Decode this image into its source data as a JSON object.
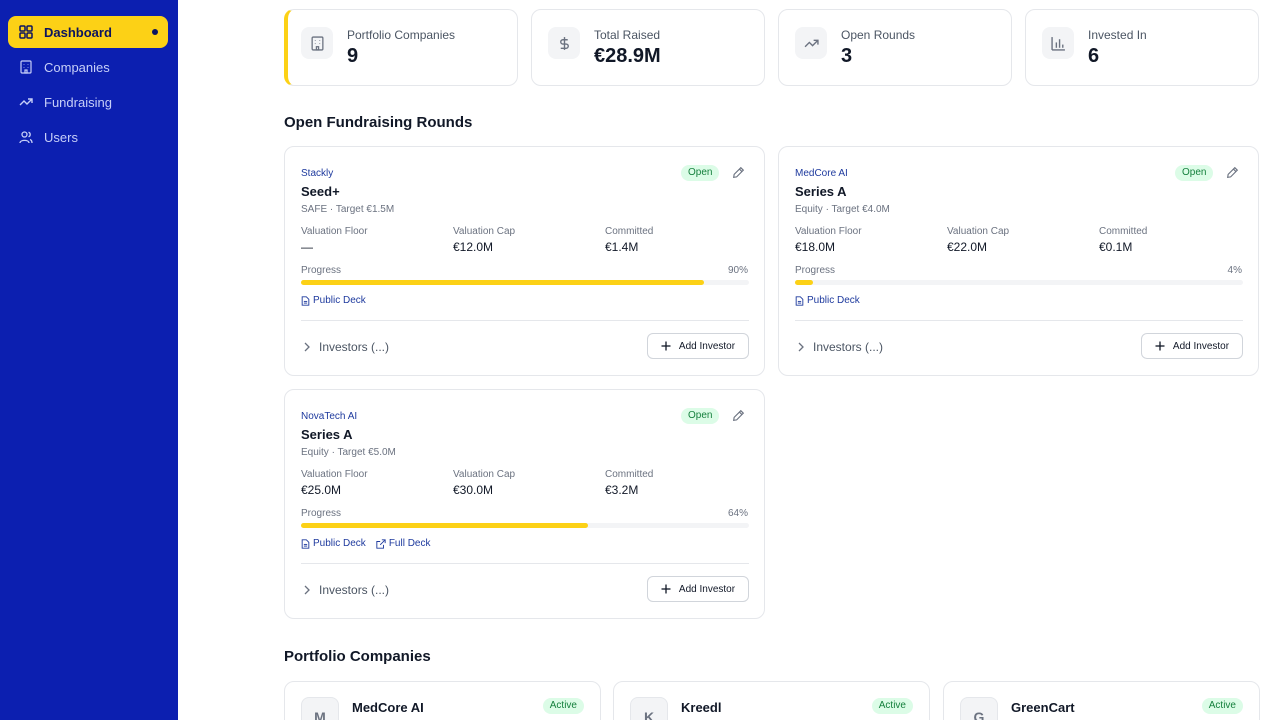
{
  "sidebar": {
    "items": [
      {
        "label": "Dashboard",
        "icon": "dashboard-icon",
        "active": true
      },
      {
        "label": "Companies",
        "icon": "building-icon"
      },
      {
        "label": "Fundraising",
        "icon": "trending-up-icon"
      },
      {
        "label": "Users",
        "icon": "users-icon"
      }
    ]
  },
  "stats": [
    {
      "label": "Portfolio Companies",
      "value": "9",
      "icon": "building-icon"
    },
    {
      "label": "Total Raised",
      "value": "€28.9M",
      "icon": "dollar-icon"
    },
    {
      "label": "Open Rounds",
      "value": "3",
      "icon": "trending-up-icon"
    },
    {
      "label": "Invested In",
      "value": "6",
      "icon": "bar-chart-icon"
    }
  ],
  "rounds_section": {
    "title": "Open Fundraising Rounds"
  },
  "rounds": [
    {
      "company": "Stackly",
      "name": "Seed+",
      "type": "SAFE · Target €1.5M",
      "status": "Open",
      "floor_label": "Valuation Floor",
      "floor": "—",
      "cap_label": "Valuation Cap",
      "cap": "€12.0M",
      "committed_label": "Committed",
      "committed": "€1.4M",
      "progress_label": "Progress",
      "progress_text": "90%",
      "progress": 0.9,
      "links": [
        "Public Deck"
      ],
      "investors": "Investors (...)",
      "add_investor": "Add Investor"
    },
    {
      "company": "MedCore AI",
      "name": "Series A",
      "type": "Equity · Target €4.0M",
      "status": "Open",
      "floor_label": "Valuation Floor",
      "floor": "€18.0M",
      "cap_label": "Valuation Cap",
      "cap": "€22.0M",
      "committed_label": "Committed",
      "committed": "€0.1M",
      "progress_label": "Progress",
      "progress_text": "4%",
      "progress": 0.04,
      "links": [
        "Public Deck"
      ],
      "investors": "Investors (...)",
      "add_investor": "Add Investor"
    },
    {
      "company": "NovaTech AI",
      "name": "Series A",
      "type": "Equity · Target €5.0M",
      "status": "Open",
      "floor_label": "Valuation Floor",
      "floor": "€25.0M",
      "cap_label": "Valuation Cap",
      "cap": "€30.0M",
      "committed_label": "Committed",
      "committed": "€3.2M",
      "progress_label": "Progress",
      "progress_text": "64%",
      "progress": 0.64,
      "links": [
        "Public Deck",
        "Full Deck"
      ],
      "investors": "Investors (...)",
      "add_investor": "Add Investor"
    }
  ],
  "portfolio_section": {
    "title": "Portfolio Companies"
  },
  "portfolio": [
    {
      "initial": "M",
      "name": "MedCore AI",
      "status": "Active"
    },
    {
      "initial": "K",
      "name": "Kreedl",
      "status": "Active"
    },
    {
      "initial": "G",
      "name": "GreenCart",
      "status": "Active"
    }
  ],
  "colors": {
    "sidebar": "#0c1fb0",
    "accent": "#fcd116",
    "link": "#1e3a9e",
    "badge_bg": "#dcfce7",
    "badge_text": "#15803d"
  }
}
